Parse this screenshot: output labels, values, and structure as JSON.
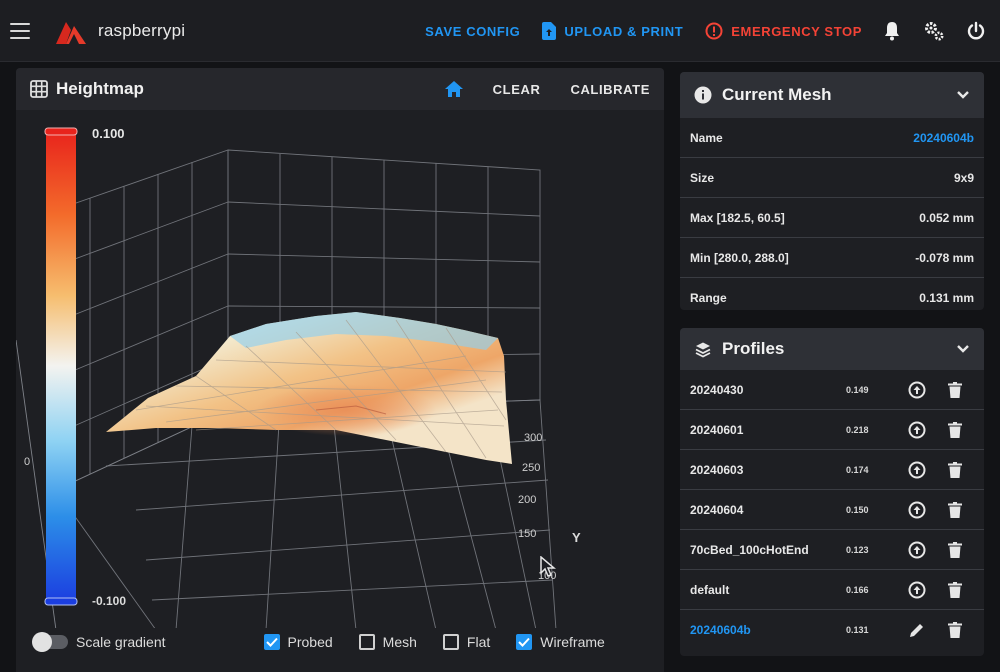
{
  "app": {
    "brand": "raspberrypi",
    "accent": "#2196f3",
    "danger": "#f44336"
  },
  "topbar": {
    "save_config": "SAVE CONFIG",
    "upload_print": "UPLOAD & PRINT",
    "emergency_stop": "EMERGENCY STOP",
    "icons": [
      "menu-icon",
      "bell-icon",
      "gears-icon",
      "power-icon"
    ]
  },
  "heightmap": {
    "title": "Heightmap",
    "clear": "CLEAR",
    "calibrate": "CALIBRATE",
    "scale_gradient": "Scale gradient",
    "scale_gradient_on": false,
    "options": [
      {
        "label": "Probed",
        "checked": true
      },
      {
        "label": "Mesh",
        "checked": false
      },
      {
        "label": "Flat",
        "checked": false
      },
      {
        "label": "Wireframe",
        "checked": true
      }
    ]
  },
  "chart_data": {
    "type": "surface",
    "scale": {
      "max": "0.100",
      "zero": "0",
      "min": "-0.100"
    },
    "y_axis": {
      "label": "Y",
      "ticks": [
        "300",
        "250",
        "200",
        "150",
        "100"
      ]
    }
  },
  "current_mesh": {
    "title": "Current Mesh",
    "rows": [
      {
        "key": "Name",
        "value": "20240604b",
        "accent": true
      },
      {
        "key": "Size",
        "value": "9x9"
      },
      {
        "key": "Max [182.5, 60.5]",
        "value": "0.052 mm"
      },
      {
        "key": "Min [280.0, 288.0]",
        "value": "-0.078 mm"
      },
      {
        "key": "Range",
        "value": "0.131 mm"
      }
    ]
  },
  "profiles": {
    "title": "Profiles",
    "items": [
      {
        "name": "20240430",
        "value": "0.149",
        "active": false
      },
      {
        "name": "20240601",
        "value": "0.218",
        "active": false
      },
      {
        "name": "20240603",
        "value": "0.174",
        "active": false
      },
      {
        "name": "20240604",
        "value": "0.150",
        "active": false
      },
      {
        "name": "70cBed_100cHotEnd",
        "value": "0.123",
        "active": false
      },
      {
        "name": "default",
        "value": "0.166",
        "active": false
      },
      {
        "name": "20240604b",
        "value": "0.131",
        "active": true
      }
    ]
  }
}
